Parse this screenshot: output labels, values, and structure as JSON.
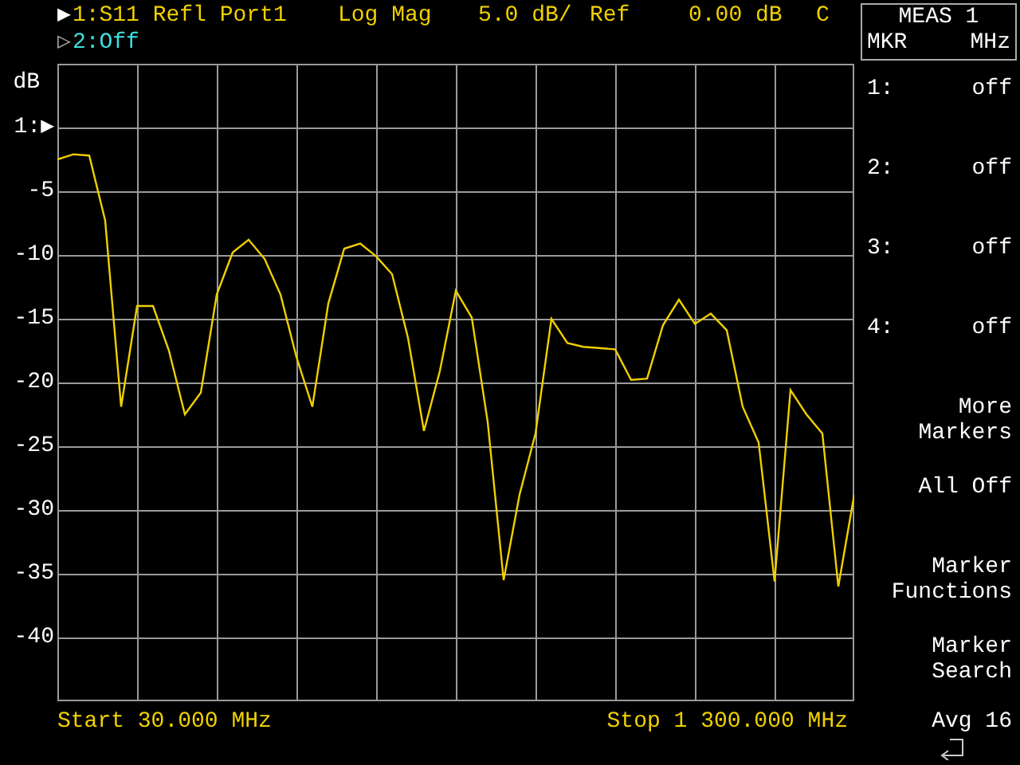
{
  "traces": [
    {
      "marker": "▶",
      "channel": "1:S11 Refl Port1",
      "format": "Log Mag",
      "scale": "5.0 dB/",
      "ref": "Ref",
      "ref_value": "0.00 dB",
      "flag": "C",
      "color": "#f0d000"
    },
    {
      "marker": "▷",
      "channel": "2:Off",
      "color": "#40e0e0"
    }
  ],
  "chart_data": {
    "type": "line",
    "ylabel": "dB",
    "ylim": [
      -45,
      5
    ],
    "grid": true,
    "categories": [
      null,
      null,
      null,
      null,
      null,
      null,
      null,
      null,
      null,
      null,
      null,
      null,
      null,
      null,
      null,
      null,
      null,
      null,
      null,
      null,
      null,
      null,
      null,
      null,
      null,
      null,
      null,
      null,
      null,
      null,
      null,
      null,
      null,
      null,
      null,
      null,
      null,
      null,
      null,
      null,
      null,
      null,
      null,
      null,
      null,
      null,
      null,
      null,
      null,
      null,
      null
    ],
    "yticks": [
      {
        "value": -5,
        "label": "-5"
      },
      {
        "value": -10,
        "label": "-10"
      },
      {
        "value": -15,
        "label": "-15"
      },
      {
        "value": -20,
        "label": "-20"
      },
      {
        "value": -25,
        "label": "-25"
      },
      {
        "value": -30,
        "label": "-30"
      },
      {
        "value": -35,
        "label": "-35"
      },
      {
        "value": -40,
        "label": "-40"
      }
    ],
    "series": [
      {
        "color": "#f0d000",
        "values": [
          -2.5,
          -2.1,
          -2.2,
          -7.3,
          -21.9,
          -14,
          -14,
          -17.5,
          -22.5,
          -20.8,
          -13.1,
          -9.8,
          -8.8,
          -10.3,
          -13.1,
          -18,
          -21.9,
          -13.8,
          -9.5,
          -9.1,
          -10.1,
          -11.5,
          -16.5,
          -23.8,
          -19.1,
          -12.8,
          -14.9,
          -23.1,
          -35.5,
          -28.8,
          -24,
          -15,
          -16.9,
          -17.2,
          -17.3,
          -17.4,
          -19.8,
          -19.7,
          -15.5,
          -13.5,
          -15.4,
          -14.6,
          -15.9,
          -21.9,
          -24.7,
          -35.6,
          -20.6,
          -22.5,
          -24,
          -36,
          -28.8
        ]
      }
    ]
  },
  "reference_marker": "1:▶",
  "meas_box": {
    "title": "MEAS 1",
    "left": "MKR",
    "right": "MHz"
  },
  "softkeys": [
    {
      "kind": "marker",
      "label": "1:",
      "value": "off"
    },
    {
      "kind": "marker",
      "label": "2:",
      "value": "off"
    },
    {
      "kind": "marker",
      "label": "3:",
      "value": "off"
    },
    {
      "kind": "marker",
      "label": "4:",
      "value": "off"
    },
    {
      "kind": "key",
      "lines": [
        "More",
        "Markers"
      ]
    },
    {
      "kind": "key",
      "lines": [
        "All Off"
      ]
    },
    {
      "kind": "key",
      "lines": [
        "Marker",
        "Functions"
      ]
    },
    {
      "kind": "key",
      "lines": [
        "Marker",
        "Search"
      ]
    }
  ],
  "status": "Avg 16",
  "footer": {
    "start": "Start 30.000 MHz",
    "stop": "Stop 1 300.000 MHz"
  }
}
